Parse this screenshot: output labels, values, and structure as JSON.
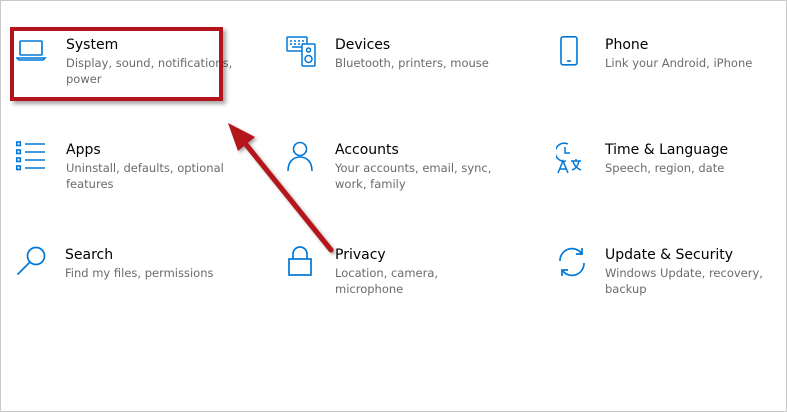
{
  "accent_color": "#0078d7",
  "annotation_color": "#b4121c",
  "tiles": [
    {
      "title": "System",
      "desc": "Display, sound, notifications, power",
      "icon": "laptop-icon"
    },
    {
      "title": "Devices",
      "desc": "Bluetooth, printers, mouse",
      "icon": "keyboard-speaker-icon"
    },
    {
      "title": "Phone",
      "desc": "Link your Android, iPhone",
      "icon": "phone-icon"
    },
    {
      "title": "Apps",
      "desc": "Uninstall, defaults, optional features",
      "icon": "list-icon"
    },
    {
      "title": "Accounts",
      "desc": "Your accounts, email, sync, work, family",
      "icon": "person-icon"
    },
    {
      "title": "Time & Language",
      "desc": "Speech, region, date",
      "icon": "clock-language-icon"
    },
    {
      "title": "Search",
      "desc": "Find my files, permissions",
      "icon": "magnifier-icon"
    },
    {
      "title": "Privacy",
      "desc": "Location, camera, microphone",
      "icon": "lock-icon"
    },
    {
      "title": "Update & Security",
      "desc": "Windows Update, recovery, backup",
      "icon": "sync-icon"
    }
  ]
}
